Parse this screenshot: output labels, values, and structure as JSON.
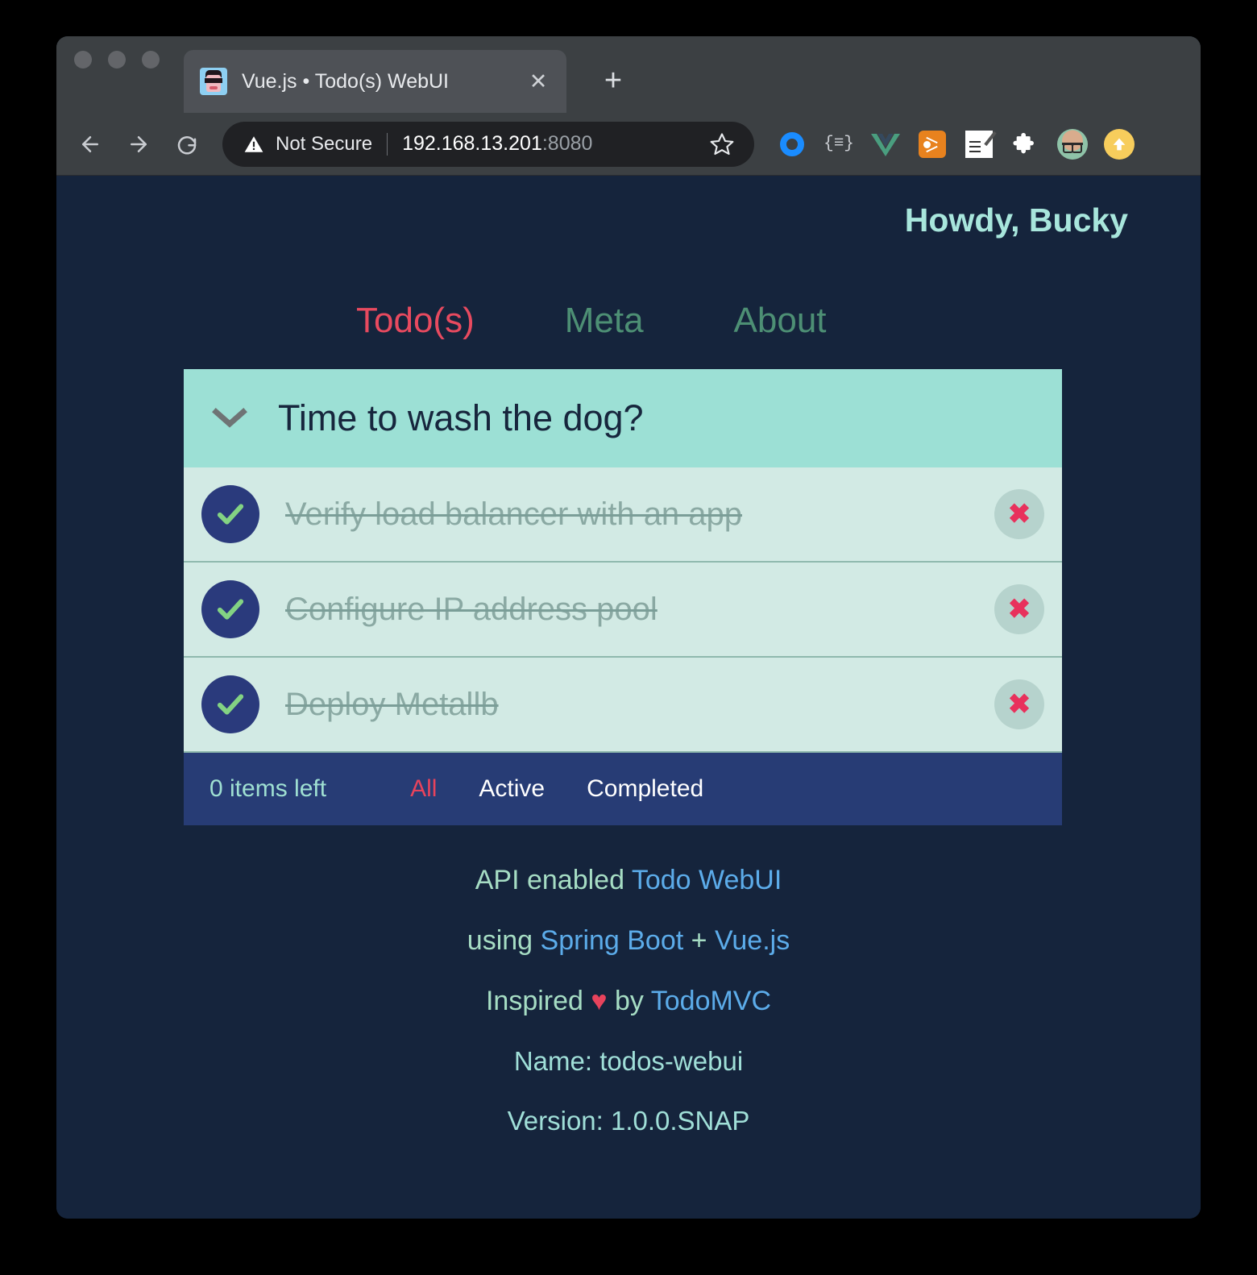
{
  "browser": {
    "tab": {
      "title": "Vue.js • Todo(s) WebUI",
      "favicon": "pixel-face-favicon",
      "close_label": "✕"
    },
    "new_tab_label": "+",
    "nav": {
      "back": "back-arrow",
      "forward": "forward-arrow",
      "reload": "reload-arrow"
    },
    "omnibox": {
      "security_label": "Not Secure",
      "url_host": "192.168.13.201",
      "url_port": ":8080",
      "star": "☆"
    },
    "extensions": [
      {
        "name": "blue-ring-icon"
      },
      {
        "name": "json-formatter-icon",
        "label": "{≡}"
      },
      {
        "name": "vue-devtools-icon"
      },
      {
        "name": "share-graph-icon"
      },
      {
        "name": "notes-checklist-icon"
      },
      {
        "name": "puzzle-extensions-icon"
      },
      {
        "name": "profile-avatar-icon"
      },
      {
        "name": "upload-arrow-icon"
      }
    ]
  },
  "app": {
    "greeting": "Howdy, Bucky",
    "nav_tabs": [
      {
        "label": "Todo(s)",
        "active": true
      },
      {
        "label": "Meta",
        "active": false
      },
      {
        "label": "About",
        "active": false
      }
    ],
    "new_todo_placeholder": "Time to wash the dog?",
    "toggle_all": "chevron-down-icon",
    "todos": [
      {
        "title": "Verify load balancer with an app",
        "completed": true
      },
      {
        "title": "Configure IP address pool",
        "completed": true
      },
      {
        "title": "Deploy Metallb",
        "completed": true
      }
    ],
    "footer": {
      "items_left": "0 items left",
      "filters": [
        {
          "label": "All",
          "active": true
        },
        {
          "label": "Active",
          "active": false
        },
        {
          "label": "Completed",
          "active": false
        }
      ]
    },
    "info": {
      "line1_prefix": "API enabled ",
      "line1_link": "Todo WebUI",
      "line2_prefix": "using ",
      "line2_link1": "Spring Boot",
      "line2_plus": " + ",
      "line2_link2": "Vue.js",
      "line3_prefix": "Inspired ",
      "line3_heart": "♥",
      "line3_mid": " by ",
      "line3_link": "TodoMVC",
      "name": "Name: todos-webui",
      "version": "Version: 1.0.0.SNAP"
    }
  },
  "colors": {
    "page_bg": "#15243c",
    "header_mint": "#9ce0d5",
    "row_mint": "#d2eae4",
    "footer_indigo": "#273c75",
    "accent_pink": "#e84a5f",
    "link_blue": "#5cacea",
    "greeting_aqua": "#a8e6dc",
    "checkbox_navy": "#2a3a7c",
    "check_green": "#83d383"
  }
}
